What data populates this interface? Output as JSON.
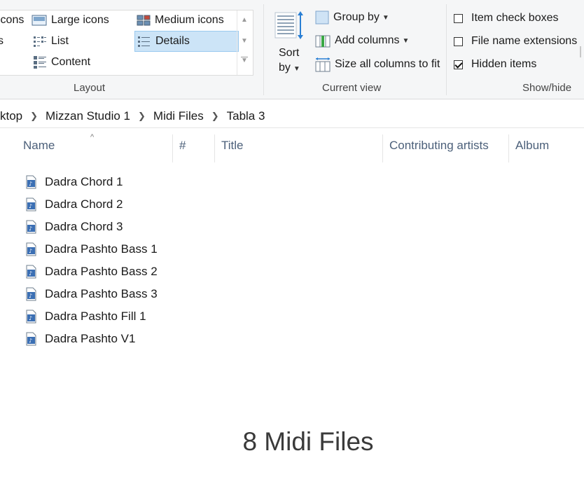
{
  "ribbon": {
    "layout": {
      "group_label": "Layout",
      "items": {
        "extra_large_icons": "icons",
        "large_icons": "Large icons",
        "medium_icons": "Medium icons",
        "small_icons": "s",
        "list": "List",
        "details": "Details",
        "content": "Content"
      },
      "selected": "Details"
    },
    "current_view": {
      "group_label": "Current view",
      "sort_by_line1": "Sort",
      "sort_by_line2": "by",
      "group_by": "Group by",
      "add_columns": "Add columns",
      "size_all_columns": "Size all columns to fit"
    },
    "show_hide": {
      "group_label": "Show/hide",
      "item_check_boxes": {
        "label": "Item check boxes",
        "checked": false
      },
      "file_name_extensions": {
        "label": "File name extensions",
        "checked": false
      },
      "hidden_items": {
        "label": "Hidden items",
        "checked": true
      }
    }
  },
  "address_bar": {
    "breadcrumbs": [
      "ktop",
      "Mizzan Studio 1",
      "Midi Files",
      "Tabla 3"
    ]
  },
  "columns": [
    "Name",
    "#",
    "Title",
    "Contributing artists",
    "Album"
  ],
  "files": [
    "Dadra Chord 1",
    "Dadra Chord 2",
    "Dadra Chord 3",
    "Dadra Pashto Bass 1",
    "Dadra Pashto Bass 2",
    "Dadra Pashto Bass 3",
    "Dadra Pashto Fill 1",
    "Dadra Pashto V1"
  ],
  "status_overlay": "8 Midi Files",
  "colors": {
    "selection_bg": "#cce4f7",
    "header_text": "#4c607a",
    "ribbon_bg": "#f5f6f7"
  }
}
